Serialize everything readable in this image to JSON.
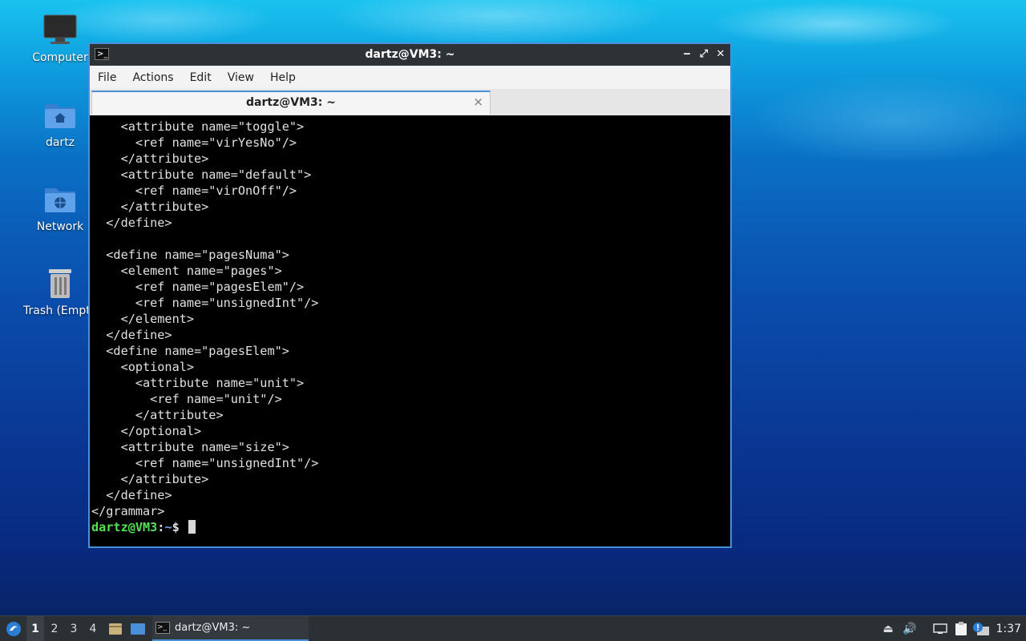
{
  "desktop": {
    "icons": [
      {
        "label": "Computer",
        "icon": "monitor-icon"
      },
      {
        "label": "dartz",
        "icon": "home-folder-icon"
      },
      {
        "label": "Network",
        "icon": "network-folder-icon"
      },
      {
        "label": "Trash (Empty)",
        "icon": "trash-icon"
      }
    ]
  },
  "window": {
    "title": "dartz@VM3: ~",
    "controls": {
      "minimize": "‒",
      "maximize": "⤢",
      "close": "✕"
    },
    "menu": [
      "File",
      "Actions",
      "Edit",
      "View",
      "Help"
    ],
    "tab": {
      "title": "dartz@VM3: ~",
      "close": "×"
    },
    "terminal": {
      "lines": [
        "    <attribute name=\"toggle\">",
        "      <ref name=\"virYesNo\"/>",
        "    </attribute>",
        "    <attribute name=\"default\">",
        "      <ref name=\"virOnOff\"/>",
        "    </attribute>",
        "  </define>",
        "",
        "  <define name=\"pagesNuma\">",
        "    <element name=\"pages\">",
        "      <ref name=\"pagesElem\"/>",
        "      <ref name=\"unsignedInt\"/>",
        "    </element>",
        "  </define>",
        "  <define name=\"pagesElem\">",
        "    <optional>",
        "      <attribute name=\"unit\">",
        "        <ref name=\"unit\"/>",
        "      </attribute>",
        "    </optional>",
        "    <attribute name=\"size\">",
        "      <ref name=\"unsignedInt\"/>",
        "    </attribute>",
        "  </define>",
        "</grammar>"
      ],
      "prompt": {
        "user_host": "dartz@VM3",
        "separator": ":",
        "dir": "~",
        "symbol": "$ "
      }
    }
  },
  "taskbar": {
    "workspaces": [
      "1",
      "2",
      "3",
      "4"
    ],
    "active_workspace": "1",
    "task": {
      "label": "dartz@VM3: ~"
    },
    "clock": "1:37"
  },
  "colors": {
    "accent": "#4a90d9",
    "prompt_user": "#55e055",
    "prompt_dir": "#6ba7e8",
    "taskbar": "#2b3034"
  }
}
